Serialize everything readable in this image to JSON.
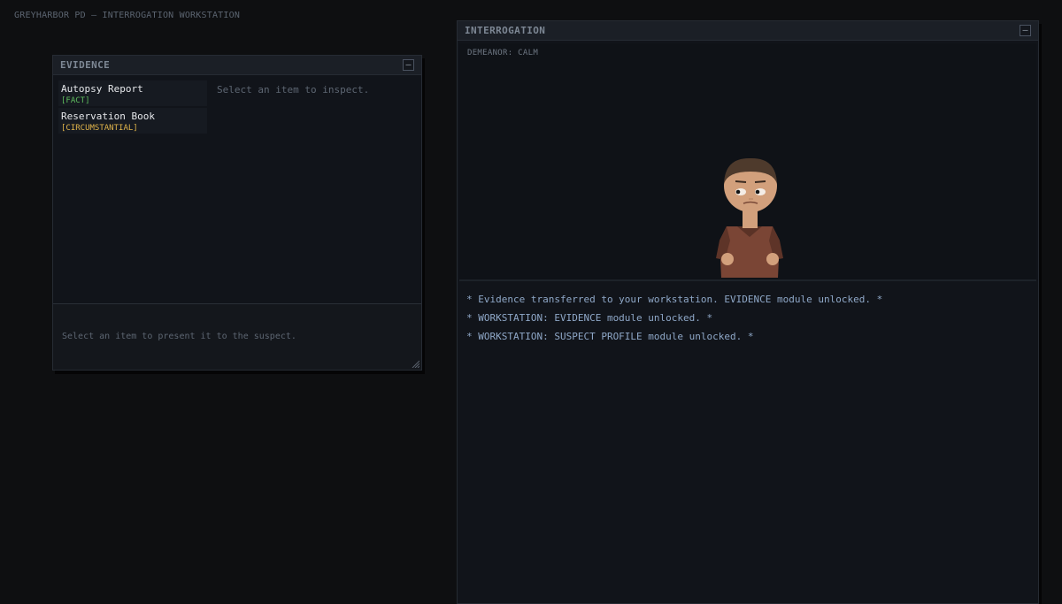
{
  "app": {
    "title": "GREYHARBOR PD — INTERROGATION WORKSTATION"
  },
  "evidence_window": {
    "title": "EVIDENCE",
    "minimize_label": "–",
    "items": [
      {
        "name": "Autopsy Report",
        "tag": "[FACT]"
      },
      {
        "name": "Reservation Book",
        "tag": "[CIRCUMSTANTIAL]"
      }
    ],
    "detail_placeholder": "Select an item to inspect.",
    "present_hint": "Select an item to present it to the suspect."
  },
  "interrogation_window": {
    "title": "INTERROGATION",
    "minimize_label": "–",
    "demeanor": "DEMEANOR: CALM",
    "log": [
      "* Evidence transferred to your workstation. EVIDENCE module unlocked. *",
      "* WORKSTATION: EVIDENCE module unlocked. *",
      "* WORKSTATION: SUSPECT PROFILE module unlocked. *"
    ]
  },
  "colors": {
    "background": "#0e0f11",
    "fact_tag": "#5fbf5f",
    "circumstantial_tag": "#e0b44a",
    "log_text": "#8fa8c8"
  }
}
